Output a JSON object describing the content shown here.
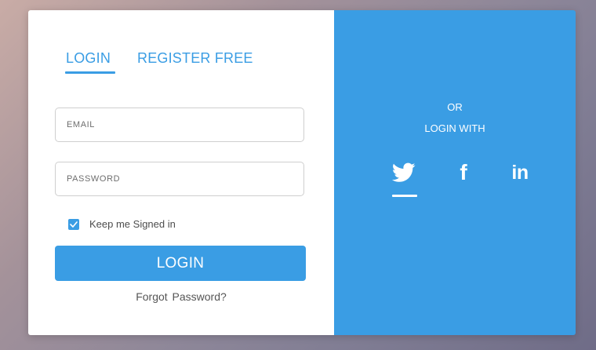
{
  "tabs": {
    "login": "LOGIN",
    "register": "REGISTER FREE",
    "active": "login"
  },
  "form": {
    "email_placeholder": "EMAIL",
    "email_value": "",
    "password_placeholder": "PASSWORD",
    "password_value": "",
    "keep_signed_in_label": "Keep me Signed in",
    "keep_signed_in_checked": true,
    "login_button": "LOGIN",
    "forgot_password": "Forgot  Password?"
  },
  "social_panel": {
    "or_text": "OR",
    "login_with_text": "LOGIN WITH",
    "providers": [
      {
        "name": "twitter",
        "icon": "twitter-icon",
        "active": true
      },
      {
        "name": "facebook",
        "icon": "facebook-icon",
        "active": false
      },
      {
        "name": "linkedin",
        "icon": "linkedin-icon",
        "active": false
      }
    ],
    "facebook_glyph": "f",
    "linkedin_glyph": "in"
  },
  "colors": {
    "accent": "#3a9de4",
    "panel_bg": "#3a9de4",
    "card_bg": "#ffffff"
  }
}
